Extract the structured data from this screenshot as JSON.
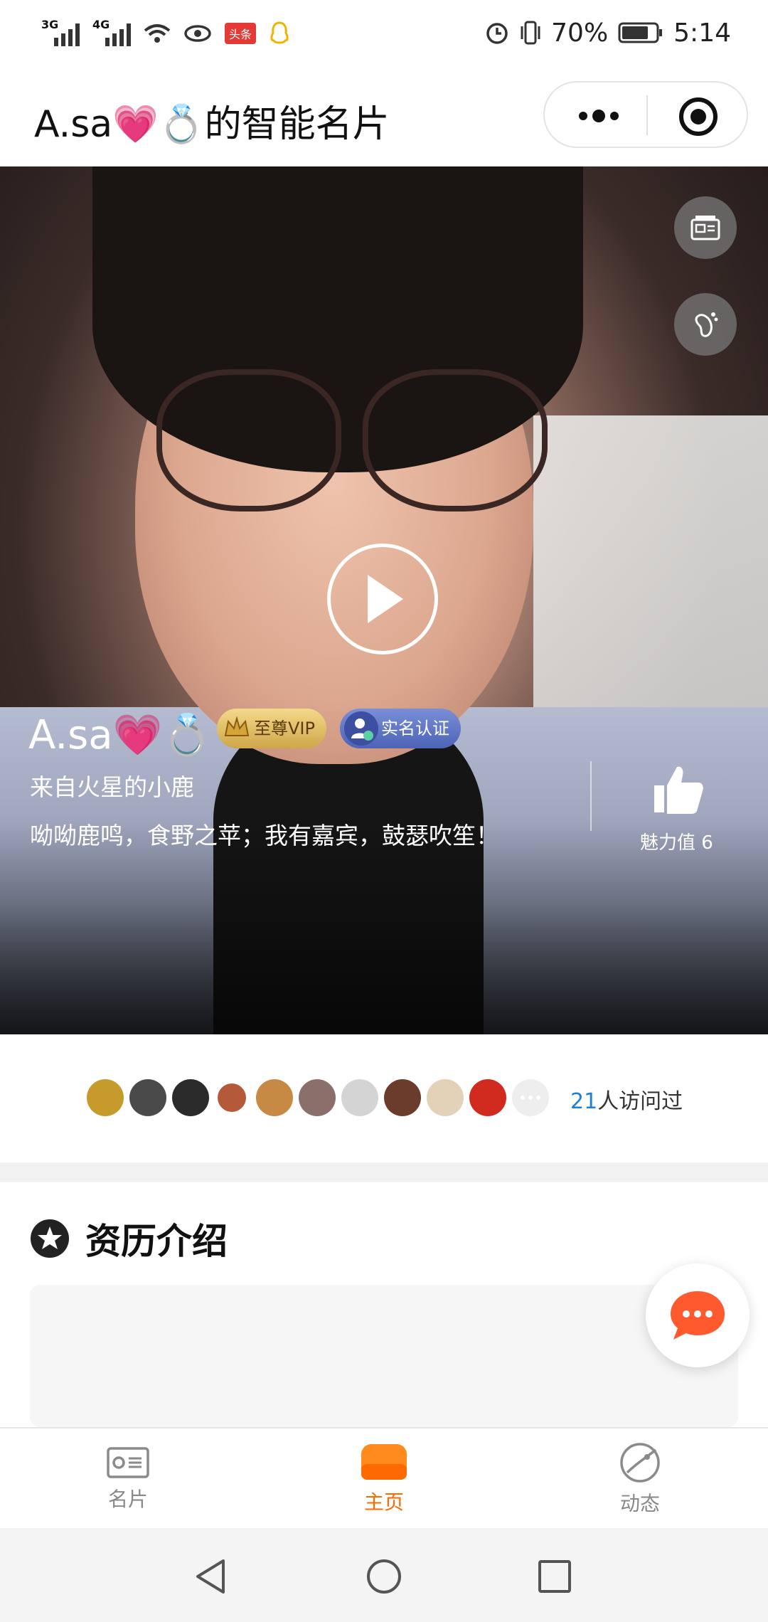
{
  "status_bar": {
    "left_labels": [
      "3G",
      "4G"
    ],
    "news_badge": "头条",
    "battery": "70%",
    "time": "5:14"
  },
  "title_bar": {
    "title": "A.sa💗💍的智能名片"
  },
  "profile": {
    "name": "A.sa💗💍",
    "vip_badge": "至尊VIP",
    "verified_badge": "实名认证",
    "subtitle": "来自火星的小鹿",
    "motto": "呦呦鹿鸣，食野之苹；我有嘉宾，鼓瑟吹笙！",
    "charm_label": "魅力值 6"
  },
  "visitors": {
    "count": "21",
    "label": "人访问过",
    "avatar_colors": [
      "#c79a2c",
      "#4a4a4a",
      "#2a2a2a",
      "#b5593b",
      "#c78a45",
      "#8a6f6a",
      "#d4d4d4",
      "#6b3b2c",
      "#e3d1b8",
      "#d12b1f"
    ]
  },
  "section": {
    "title": "资历介绍"
  },
  "tabs": [
    {
      "label": "名片",
      "icon": "card-icon",
      "active": false
    },
    {
      "label": "主页",
      "icon": "home-icon",
      "active": true
    },
    {
      "label": "动态",
      "icon": "planet-icon",
      "active": false
    }
  ],
  "colors": {
    "accent": "#ff6a00",
    "link": "#1e7fd6"
  }
}
